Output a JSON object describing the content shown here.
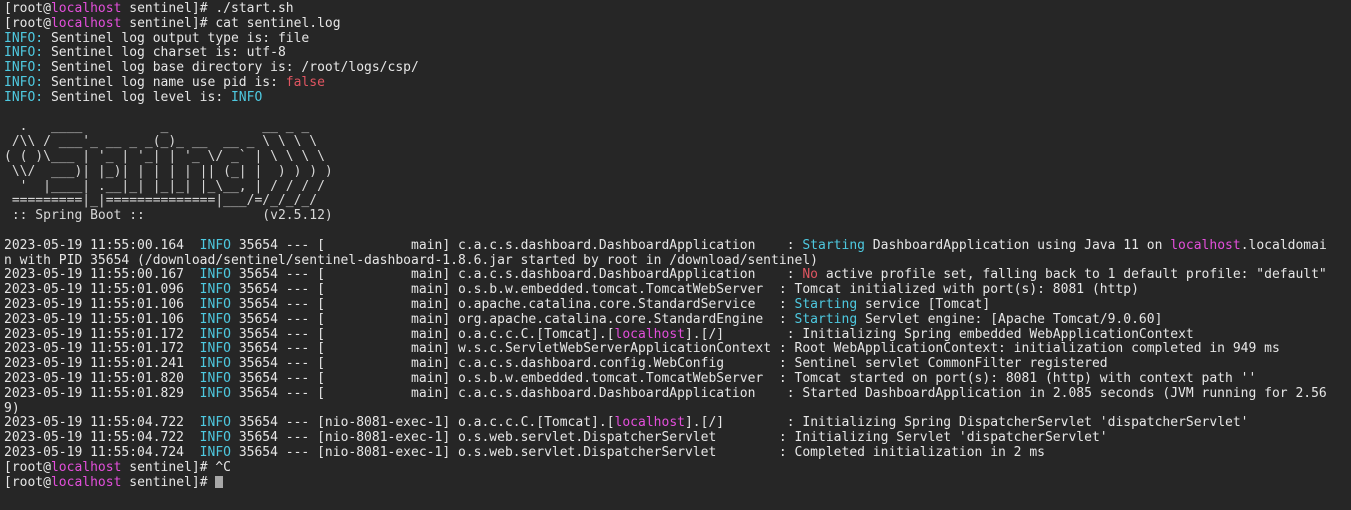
{
  "terminal": {
    "window_title": "Terminal",
    "colors": {
      "background": "#262626",
      "foreground": "#e6e6e6",
      "cyan": "#4ec9e0",
      "magenta": "#e34fdb",
      "red": "#e05561",
      "cursor": "#a8a8a8"
    },
    "prompt": {
      "open_bracket": "[",
      "user": "root",
      "at": "@",
      "host": "localhost",
      "space": " ",
      "cwd": "sentinel",
      "close": "]# "
    },
    "commands": {
      "first": "./start.sh",
      "second": "cat sentinel.log",
      "interrupt": "^C"
    },
    "sentinel_info": [
      {
        "label": "INFO:",
        "text": " Sentinel log output type is: file"
      },
      {
        "label": "INFO:",
        "text": " Sentinel log charset is: utf-8"
      },
      {
        "label": "INFO:",
        "text": " Sentinel log base directory is: /root/logs/csp/"
      },
      {
        "label": "INFO:",
        "text": " Sentinel log name use pid is: ",
        "value": "false",
        "value_color": "red"
      },
      {
        "label": "INFO:",
        "text": " Sentinel log level is: ",
        "value": "INFO",
        "value_color": "cyan"
      }
    ],
    "banner": {
      "lines": [
        "  .   ____          _            __ _ _",
        " /\\\\ / ___'_ __ _ _(_)_ __  __ _ \\ \\ \\ \\",
        "( ( )\\___ | '_ | '_| | '_ \\/ _` | \\ \\ \\ \\",
        " \\\\/  ___)| |_)| | | | | || (_| |  ) ) ) )",
        "  '  |____| .__|_| |_|_| |_\\__, | / / / /",
        " =========|_|==============|___/=/_/_/_/"
      ],
      "footer_label": " :: Spring Boot :: ",
      "footer_version": "              (v2.5.12)"
    },
    "log_lines": [
      {
        "timestamp": "2023-05-19 11:55:00.164",
        "level": "INFO",
        "pid": "35654",
        "sep": "---",
        "thread": "[           main]",
        "logger": "c.a.c.s.dashboard.DashboardApplication    : ",
        "msg_prefix": "Starting",
        "msg_prefix_color": "cyan",
        "msg_mid": " DashboardApplication using Java 11 on ",
        "msg_host": "localhost",
        "msg_host_color": "magenta",
        "msg_tail": ".localdomai"
      },
      {
        "continuation": "n with PID 35654 (/download/sentinel/sentinel-dashboard-1.8.6.jar started by root in /download/sentinel)"
      },
      {
        "timestamp": "2023-05-19 11:55:00.167",
        "level": "INFO",
        "pid": "35654",
        "sep": "---",
        "thread": "[           main]",
        "logger": "c.a.c.s.dashboard.DashboardApplication    : ",
        "msg_prefix": "No",
        "msg_prefix_color": "red",
        "msg_mid": " active profile set, falling back to 1 default profile: \"default\"",
        "msg_host": "",
        "msg_tail": ""
      },
      {
        "timestamp": "2023-05-19 11:55:01.096",
        "level": "INFO",
        "pid": "35654",
        "sep": "---",
        "thread": "[           main]",
        "logger": "o.s.b.w.embedded.tomcat.TomcatWebServer  : ",
        "msg_prefix": "",
        "msg_mid": "Tomcat initialized with port(s): 8081 (http)",
        "msg_host": "",
        "msg_tail": ""
      },
      {
        "timestamp": "2023-05-19 11:55:01.106",
        "level": "INFO",
        "pid": "35654",
        "sep": "---",
        "thread": "[           main]",
        "logger": "o.apache.catalina.core.StandardService   : ",
        "msg_prefix": "Starting",
        "msg_prefix_color": "cyan",
        "msg_mid": " service [Tomcat]",
        "msg_host": "",
        "msg_tail": ""
      },
      {
        "timestamp": "2023-05-19 11:55:01.106",
        "level": "INFO",
        "pid": "35654",
        "sep": "---",
        "thread": "[           main]",
        "logger": "org.apache.catalina.core.StandardEngine  : ",
        "msg_prefix": "Starting",
        "msg_prefix_color": "cyan",
        "msg_mid": " Servlet engine: [Apache Tomcat/9.0.60]",
        "msg_host": "",
        "msg_tail": ""
      },
      {
        "timestamp": "2023-05-19 11:55:01.172",
        "level": "INFO",
        "pid": "35654",
        "sep": "---",
        "thread": "[           main]",
        "logger_pre": "o.a.c.c.C.[Tomcat].[",
        "logger_host": "localhost",
        "logger_host_color": "magenta",
        "logger_post": "].[/]        : ",
        "msg_prefix": "",
        "msg_mid": "Initializing Spring embedded WebApplicationContext",
        "msg_host": "",
        "msg_tail": ""
      },
      {
        "timestamp": "2023-05-19 11:55:01.172",
        "level": "INFO",
        "pid": "35654",
        "sep": "---",
        "thread": "[           main]",
        "logger": "w.s.c.ServletWebServerApplicationContext : ",
        "msg_prefix": "",
        "msg_mid": "Root WebApplicationContext: initialization completed in 949 ms",
        "msg_host": "",
        "msg_tail": ""
      },
      {
        "timestamp": "2023-05-19 11:55:01.241",
        "level": "INFO",
        "pid": "35654",
        "sep": "---",
        "thread": "[           main]",
        "logger": "c.a.c.s.dashboard.config.WebConfig       : ",
        "msg_prefix": "",
        "msg_mid": "Sentinel servlet CommonFilter registered",
        "msg_host": "",
        "msg_tail": ""
      },
      {
        "timestamp": "2023-05-19 11:55:01.820",
        "level": "INFO",
        "pid": "35654",
        "sep": "---",
        "thread": "[           main]",
        "logger": "o.s.b.w.embedded.tomcat.TomcatWebServer  : ",
        "msg_prefix": "",
        "msg_mid": "Tomcat started on port(s): 8081 (http) with context path ''",
        "msg_host": "",
        "msg_tail": ""
      },
      {
        "timestamp": "2023-05-19 11:55:01.829",
        "level": "INFO",
        "pid": "35654",
        "sep": "---",
        "thread": "[           main]",
        "logger": "c.a.c.s.dashboard.DashboardApplication    : ",
        "msg_prefix": "",
        "msg_mid": "Started DashboardApplication in 2.085 seconds (JVM running for 2.56",
        "msg_host": "",
        "msg_tail": ""
      },
      {
        "continuation": "9)"
      },
      {
        "timestamp": "2023-05-19 11:55:04.722",
        "level": "INFO",
        "pid": "35654",
        "sep": "---",
        "thread": "[nio-8081-exec-1]",
        "logger_pre": "o.a.c.c.C.[Tomcat].[",
        "logger_host": "localhost",
        "logger_host_color": "magenta",
        "logger_post": "].[/]        : ",
        "msg_prefix": "",
        "msg_mid": "Initializing Spring DispatcherServlet 'dispatcherServlet'",
        "msg_host": "",
        "msg_tail": ""
      },
      {
        "timestamp": "2023-05-19 11:55:04.722",
        "level": "INFO",
        "pid": "35654",
        "sep": "---",
        "thread": "[nio-8081-exec-1]",
        "logger": "o.s.web.servlet.DispatcherServlet        : ",
        "msg_prefix": "",
        "msg_mid": "Initializing Servlet 'dispatcherServlet'",
        "msg_host": "",
        "msg_tail": ""
      },
      {
        "timestamp": "2023-05-19 11:55:04.724",
        "level": "INFO",
        "pid": "35654",
        "sep": "---",
        "thread": "[nio-8081-exec-1]",
        "logger": "o.s.web.servlet.DispatcherServlet        : ",
        "msg_prefix": "",
        "msg_mid": "Completed initialization in 2 ms",
        "msg_host": "",
        "msg_tail": ""
      }
    ]
  }
}
